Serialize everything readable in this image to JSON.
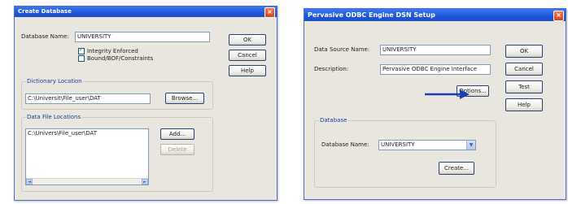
{
  "create_database": {
    "title": "Create Database",
    "close": "×",
    "database_name_label": "Database Name:",
    "database_name_value": "UNIVERSITY",
    "integrity_label": "Integrity Enforced",
    "integrity_checked": true,
    "bound_label": "Bound/BOF/Constraints",
    "bound_checked": false,
    "ok": "OK",
    "cancel": "Cancel",
    "help": "Help",
    "dictionary_location_label": "Dictionary Location",
    "dictionary_location_value": "C:\\Universit\\File_user\\DAT",
    "browse": "Browse...",
    "data_file_locations_label": "Data File Locations",
    "data_file_list": [
      "C:\\Univers\\File_user\\DAT"
    ],
    "add": "Add...",
    "delete": "Delete",
    "scroll_left": "◄",
    "scroll_right": "►"
  },
  "dsn_setup": {
    "title": "Pervasive ODBC Engine DSN Setup",
    "close": "×",
    "data_source_name_label": "Data Source Name:",
    "data_source_name_value": "UNIVERSITY",
    "description_label": "Description:",
    "description_value": "Pervasive ODBC Engine Interface",
    "options": "Options...",
    "ok": "OK",
    "cancel": "Cancel",
    "test": "Test",
    "help": "Help",
    "database_group_label": "Database",
    "database_name_label": "Database Name:",
    "database_name_value": "UNIVERSITY",
    "combo_arrow": "▼",
    "create": "Create..."
  },
  "colors": {
    "titlebar": "#1e56d8",
    "arrow": "#1f3fb0"
  }
}
